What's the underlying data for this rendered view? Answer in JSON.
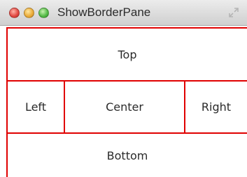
{
  "window": {
    "title": "ShowBorderPane"
  },
  "titlebar": {
    "buttons": [
      "close",
      "minimize",
      "zoom"
    ],
    "fullscreen_icon": "fullscreen-arrows-icon"
  },
  "pane": {
    "top": "Top",
    "left": "Left",
    "center": "Center",
    "right": "Right",
    "bottom": "Bottom"
  },
  "colors": {
    "border": "#e00000",
    "close": "#e0443e",
    "minimize": "#e9a935",
    "zoom": "#4fb843"
  }
}
